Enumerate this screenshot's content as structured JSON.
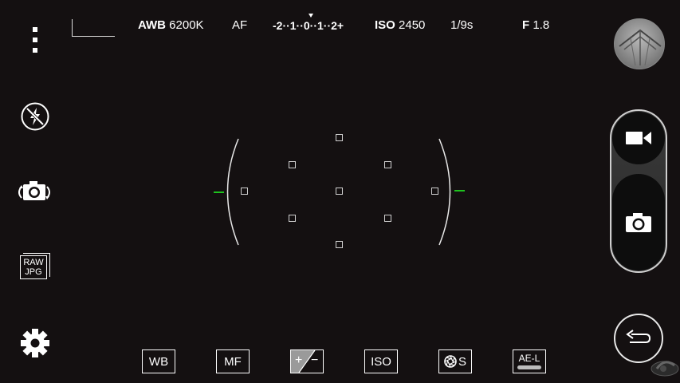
{
  "topbar": {
    "awb_label": "AWB",
    "awb_value": "6200K",
    "af_label": "AF",
    "ev_scale": "-2··1··0··1··2+",
    "iso_label": "ISO",
    "iso_value": "2450",
    "shutter": "1/9s",
    "aperture_label": "F",
    "aperture_value": "1.8"
  },
  "left_menu": {
    "menu_icon": "more-vertical-icon",
    "flash_icon": "flash-off-icon",
    "switch_camera_icon": "switch-camera-icon",
    "format_line1": "RAW",
    "format_line2": "JPG",
    "settings_icon": "gear-icon"
  },
  "controls": {
    "wb": "WB",
    "mf": "MF",
    "ev_plus": "+",
    "ev_minus": "−",
    "iso": "ISO",
    "shutter_s": "S",
    "ael": "AE-L"
  },
  "right_panel": {
    "gallery_icon": "gallery-thumbnail",
    "video_icon": "video-camera-icon",
    "shutter_icon": "camera-icon",
    "back_icon": "back-arrow-icon"
  },
  "colors": {
    "background": "#141011",
    "focus_indicator": "#1ec21e",
    "foreground": "#ffffff"
  }
}
